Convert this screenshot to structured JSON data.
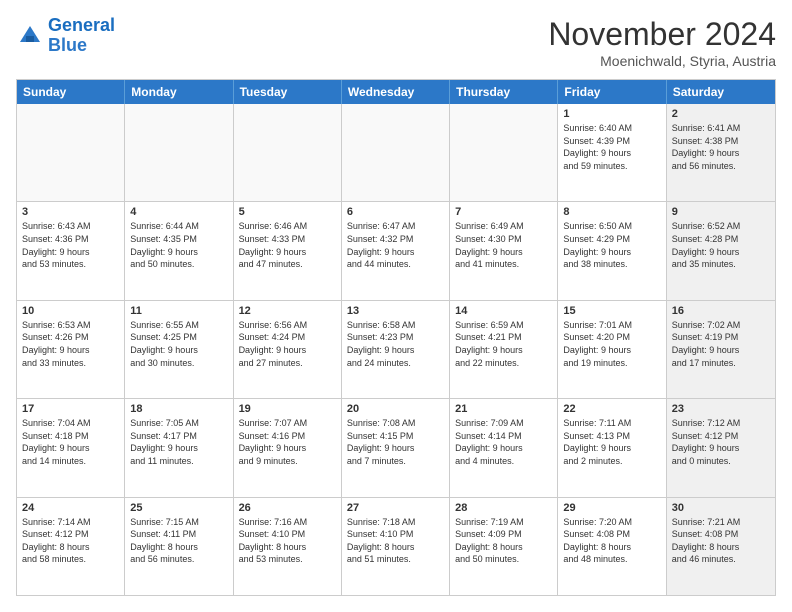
{
  "logo": {
    "line1": "General",
    "line2": "Blue"
  },
  "title": "November 2024",
  "location": "Moenichwald, Styria, Austria",
  "weekdays": [
    "Sunday",
    "Monday",
    "Tuesday",
    "Wednesday",
    "Thursday",
    "Friday",
    "Saturday"
  ],
  "rows": [
    [
      {
        "day": "",
        "info": "",
        "shaded": false,
        "empty": true
      },
      {
        "day": "",
        "info": "",
        "shaded": false,
        "empty": true
      },
      {
        "day": "",
        "info": "",
        "shaded": false,
        "empty": true
      },
      {
        "day": "",
        "info": "",
        "shaded": false,
        "empty": true
      },
      {
        "day": "",
        "info": "",
        "shaded": false,
        "empty": true
      },
      {
        "day": "1",
        "info": "Sunrise: 6:40 AM\nSunset: 4:39 PM\nDaylight: 9 hours\nand 59 minutes.",
        "shaded": false,
        "empty": false
      },
      {
        "day": "2",
        "info": "Sunrise: 6:41 AM\nSunset: 4:38 PM\nDaylight: 9 hours\nand 56 minutes.",
        "shaded": true,
        "empty": false
      }
    ],
    [
      {
        "day": "3",
        "info": "Sunrise: 6:43 AM\nSunset: 4:36 PM\nDaylight: 9 hours\nand 53 minutes.",
        "shaded": false,
        "empty": false
      },
      {
        "day": "4",
        "info": "Sunrise: 6:44 AM\nSunset: 4:35 PM\nDaylight: 9 hours\nand 50 minutes.",
        "shaded": false,
        "empty": false
      },
      {
        "day": "5",
        "info": "Sunrise: 6:46 AM\nSunset: 4:33 PM\nDaylight: 9 hours\nand 47 minutes.",
        "shaded": false,
        "empty": false
      },
      {
        "day": "6",
        "info": "Sunrise: 6:47 AM\nSunset: 4:32 PM\nDaylight: 9 hours\nand 44 minutes.",
        "shaded": false,
        "empty": false
      },
      {
        "day": "7",
        "info": "Sunrise: 6:49 AM\nSunset: 4:30 PM\nDaylight: 9 hours\nand 41 minutes.",
        "shaded": false,
        "empty": false
      },
      {
        "day": "8",
        "info": "Sunrise: 6:50 AM\nSunset: 4:29 PM\nDaylight: 9 hours\nand 38 minutes.",
        "shaded": false,
        "empty": false
      },
      {
        "day": "9",
        "info": "Sunrise: 6:52 AM\nSunset: 4:28 PM\nDaylight: 9 hours\nand 35 minutes.",
        "shaded": true,
        "empty": false
      }
    ],
    [
      {
        "day": "10",
        "info": "Sunrise: 6:53 AM\nSunset: 4:26 PM\nDaylight: 9 hours\nand 33 minutes.",
        "shaded": false,
        "empty": false
      },
      {
        "day": "11",
        "info": "Sunrise: 6:55 AM\nSunset: 4:25 PM\nDaylight: 9 hours\nand 30 minutes.",
        "shaded": false,
        "empty": false
      },
      {
        "day": "12",
        "info": "Sunrise: 6:56 AM\nSunset: 4:24 PM\nDaylight: 9 hours\nand 27 minutes.",
        "shaded": false,
        "empty": false
      },
      {
        "day": "13",
        "info": "Sunrise: 6:58 AM\nSunset: 4:23 PM\nDaylight: 9 hours\nand 24 minutes.",
        "shaded": false,
        "empty": false
      },
      {
        "day": "14",
        "info": "Sunrise: 6:59 AM\nSunset: 4:21 PM\nDaylight: 9 hours\nand 22 minutes.",
        "shaded": false,
        "empty": false
      },
      {
        "day": "15",
        "info": "Sunrise: 7:01 AM\nSunset: 4:20 PM\nDaylight: 9 hours\nand 19 minutes.",
        "shaded": false,
        "empty": false
      },
      {
        "day": "16",
        "info": "Sunrise: 7:02 AM\nSunset: 4:19 PM\nDaylight: 9 hours\nand 17 minutes.",
        "shaded": true,
        "empty": false
      }
    ],
    [
      {
        "day": "17",
        "info": "Sunrise: 7:04 AM\nSunset: 4:18 PM\nDaylight: 9 hours\nand 14 minutes.",
        "shaded": false,
        "empty": false
      },
      {
        "day": "18",
        "info": "Sunrise: 7:05 AM\nSunset: 4:17 PM\nDaylight: 9 hours\nand 11 minutes.",
        "shaded": false,
        "empty": false
      },
      {
        "day": "19",
        "info": "Sunrise: 7:07 AM\nSunset: 4:16 PM\nDaylight: 9 hours\nand 9 minutes.",
        "shaded": false,
        "empty": false
      },
      {
        "day": "20",
        "info": "Sunrise: 7:08 AM\nSunset: 4:15 PM\nDaylight: 9 hours\nand 7 minutes.",
        "shaded": false,
        "empty": false
      },
      {
        "day": "21",
        "info": "Sunrise: 7:09 AM\nSunset: 4:14 PM\nDaylight: 9 hours\nand 4 minutes.",
        "shaded": false,
        "empty": false
      },
      {
        "day": "22",
        "info": "Sunrise: 7:11 AM\nSunset: 4:13 PM\nDaylight: 9 hours\nand 2 minutes.",
        "shaded": false,
        "empty": false
      },
      {
        "day": "23",
        "info": "Sunrise: 7:12 AM\nSunset: 4:12 PM\nDaylight: 9 hours\nand 0 minutes.",
        "shaded": true,
        "empty": false
      }
    ],
    [
      {
        "day": "24",
        "info": "Sunrise: 7:14 AM\nSunset: 4:12 PM\nDaylight: 8 hours\nand 58 minutes.",
        "shaded": false,
        "empty": false
      },
      {
        "day": "25",
        "info": "Sunrise: 7:15 AM\nSunset: 4:11 PM\nDaylight: 8 hours\nand 56 minutes.",
        "shaded": false,
        "empty": false
      },
      {
        "day": "26",
        "info": "Sunrise: 7:16 AM\nSunset: 4:10 PM\nDaylight: 8 hours\nand 53 minutes.",
        "shaded": false,
        "empty": false
      },
      {
        "day": "27",
        "info": "Sunrise: 7:18 AM\nSunset: 4:10 PM\nDaylight: 8 hours\nand 51 minutes.",
        "shaded": false,
        "empty": false
      },
      {
        "day": "28",
        "info": "Sunrise: 7:19 AM\nSunset: 4:09 PM\nDaylight: 8 hours\nand 50 minutes.",
        "shaded": false,
        "empty": false
      },
      {
        "day": "29",
        "info": "Sunrise: 7:20 AM\nSunset: 4:08 PM\nDaylight: 8 hours\nand 48 minutes.",
        "shaded": false,
        "empty": false
      },
      {
        "day": "30",
        "info": "Sunrise: 7:21 AM\nSunset: 4:08 PM\nDaylight: 8 hours\nand 46 minutes.",
        "shaded": true,
        "empty": false
      }
    ]
  ]
}
